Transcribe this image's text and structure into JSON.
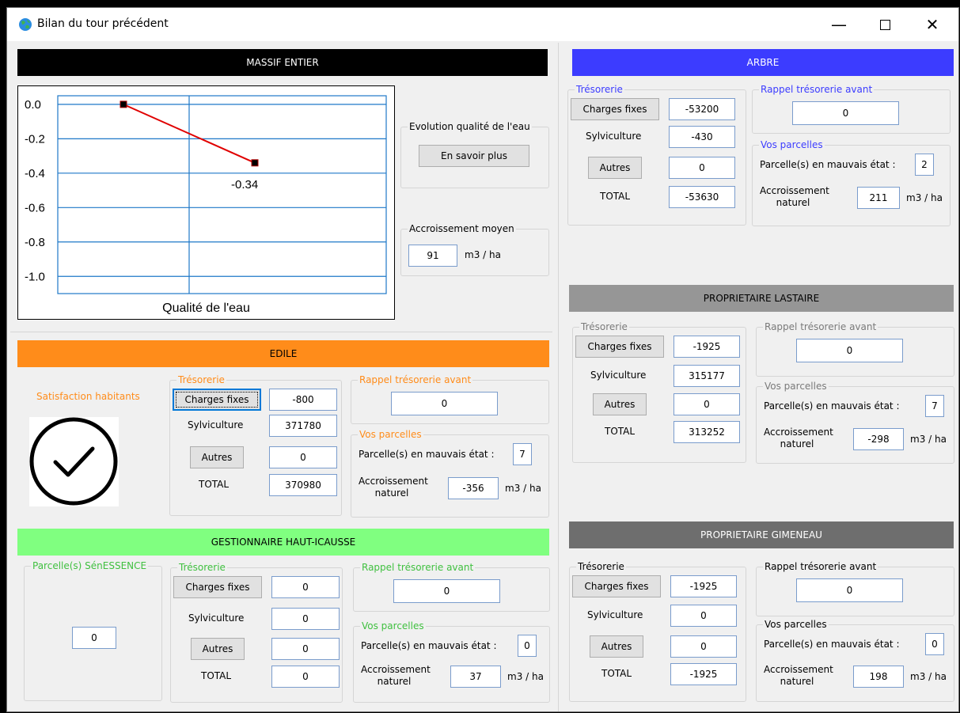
{
  "window": {
    "title": "Bilan du tour précédent"
  },
  "massif": {
    "banner": "MASSIF ENTIER",
    "chart_title": "Qualité de l'eau",
    "evolution_label": "Evolution qualité de l'eau",
    "more_button": "En savoir plus",
    "accroissement_label": "Accroissement moyen",
    "accroissement_value": "91",
    "unit": "m3 / ha"
  },
  "chart_data": {
    "type": "line",
    "title": "Qualité de l'eau",
    "xlabel": "",
    "ylabel": "",
    "ylim": [
      -1.1,
      0.05
    ],
    "yticks": [
      "0.0",
      "-0.2",
      "-0.4",
      "-0.6",
      "-0.8",
      "-1.0"
    ],
    "series": [
      {
        "x": [
          0,
          1
        ],
        "values": [
          0,
          -0.34
        ]
      }
    ],
    "data_labels": [
      "-0.34"
    ],
    "grid": true,
    "line_color": "#e00000",
    "grid_color": "#1e78c8"
  },
  "edile": {
    "banner": "EDILE",
    "satisfaction_label": "Satisfaction habitants",
    "satisfaction_icon": "check-circle-icon",
    "tresorerie": "Trésorerie",
    "charges_fixes": "Charges fixes",
    "charges_value": "-800",
    "sylviculture": "Sylviculture",
    "sylviculture_value": "371780",
    "autres": "Autres",
    "autres_value": "0",
    "total": "TOTAL",
    "total_value": "370980",
    "rappel": "Rappel trésorerie avant",
    "rappel_value": "0",
    "parcelles": "Vos parcelles",
    "mauvais": "Parcelle(s) en mauvais état :",
    "mauvais_value": "7",
    "accr1": "Accroissement",
    "accr2": "naturel",
    "accr_value": "-356",
    "unit": "m3 / ha"
  },
  "gestionnaire": {
    "banner": "GESTIONNAIRE HAUT-ICAUSSE",
    "senessence_label": "Parcelle(s) SénESSENCE",
    "senessence_value": "0",
    "tresorerie": "Trésorerie",
    "charges_fixes": "Charges fixes",
    "charges_value": "0",
    "sylviculture": "Sylviculture",
    "sylviculture_value": "0",
    "autres": "Autres",
    "autres_value": "0",
    "total": "TOTAL",
    "total_value": "0",
    "rappel": "Rappel trésorerie avant",
    "rappel_value": "0",
    "parcelles": "Vos parcelles",
    "mauvais": "Parcelle(s) en mauvais état :",
    "mauvais_value": "0",
    "accr1": "Accroissement",
    "accr2": "naturel",
    "accr_value": "37",
    "unit": "m3 / ha"
  },
  "arbre": {
    "banner": "ARBRE",
    "tresorerie": "Trésorerie",
    "charges_fixes": "Charges fixes",
    "charges_value": "-53200",
    "sylviculture": "Sylviculture",
    "sylviculture_value": "-430",
    "autres": "Autres",
    "autres_value": "0",
    "total": "TOTAL",
    "total_value": "-53630",
    "rappel": "Rappel trésorerie avant",
    "rappel_value": "0",
    "parcelles": "Vos parcelles",
    "mauvais": "Parcelle(s) en mauvais état :",
    "mauvais_value": "2",
    "accr1": "Accroissement",
    "accr2": "naturel",
    "accr_value": "211",
    "unit": "m3 / ha"
  },
  "lastaire": {
    "banner": "PROPRIETAIRE LASTAIRE",
    "tresorerie": "Trésorerie",
    "charges_fixes": "Charges fixes",
    "charges_value": "-1925",
    "sylviculture": "Sylviculture",
    "sylviculture_value": "315177",
    "autres": "Autres",
    "autres_value": "0",
    "total": "TOTAL",
    "total_value": "313252",
    "rappel": "Rappel trésorerie avant",
    "rappel_value": "0",
    "parcelles": "Vos parcelles",
    "mauvais": "Parcelle(s) en mauvais état :",
    "mauvais_value": "7",
    "accr1": "Accroissement",
    "accr2": "naturel",
    "accr_value": "-298",
    "unit": "m3 / ha"
  },
  "gimeneau": {
    "banner": "PROPRIETAIRE GIMENEAU",
    "tresorerie": "Trésorerie",
    "charges_fixes": "Charges fixes",
    "charges_value": "-1925",
    "sylviculture": "Sylviculture",
    "sylviculture_value": "0",
    "autres": "Autres",
    "autres_value": "0",
    "total": "TOTAL",
    "total_value": "-1925",
    "rappel": "Rappel trésorerie avant",
    "rappel_value": "0",
    "parcelles": "Vos parcelles",
    "mauvais": "Parcelle(s) en mauvais état :",
    "mauvais_value": "0",
    "accr1": "Accroissement",
    "accr2": "naturel",
    "accr_value": "198",
    "unit": "m3 / ha"
  },
  "colors": {
    "massif_banner": "#000000",
    "edile_banner": "#ff8c1a",
    "edile_text": "#ff8c1a",
    "gestionnaire_banner": "#80ff80",
    "gestionnaire_text": "#40c040",
    "arbre_banner": "#3c3cff",
    "arbre_text": "#3c3cff",
    "lastaire_banner": "#969696",
    "lastaire_text": "#7a7a7a",
    "gimeneau_banner": "#6e6e6e",
    "gimeneau_text": "#000000"
  }
}
